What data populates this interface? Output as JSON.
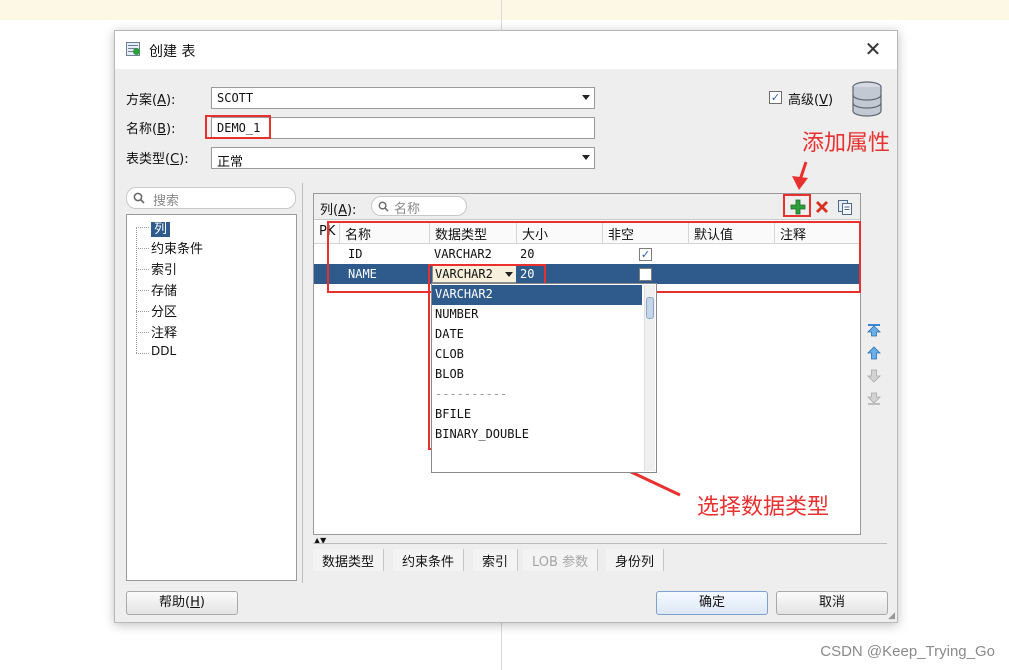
{
  "page": {
    "watermark": "CSDN @Keep_Trying_Go"
  },
  "dialog": {
    "title": "创建 表",
    "schema": {
      "label_pre": "方案(",
      "label_key": "A",
      "label_post": "):",
      "value": "SCOTT"
    },
    "name": {
      "label_pre": "名称(",
      "label_key": "B",
      "label_post": "):",
      "value": "DEMO_1"
    },
    "table_type": {
      "label_pre": "表类型(",
      "label_key": "C",
      "label_post": "):",
      "value": "正常"
    },
    "advanced": {
      "label_pre": "高级(",
      "label_key": "V",
      "label_post": ")",
      "checked": true
    }
  },
  "left_panel": {
    "search_placeholder": "搜索",
    "items": [
      {
        "label": "列",
        "selected": true
      },
      {
        "label": "约束条件"
      },
      {
        "label": "索引"
      },
      {
        "label": "存储"
      },
      {
        "label": "分区"
      },
      {
        "label": "注释"
      },
      {
        "label": "DDL"
      }
    ]
  },
  "columns_panel": {
    "label_pre": "列(",
    "label_key": "A",
    "label_post": "):",
    "search_placeholder": "名称",
    "headers": [
      "PK",
      "名称",
      "数据类型",
      "大小",
      "非空",
      "默认值",
      "注释"
    ],
    "rows": [
      {
        "pk": "",
        "name": "ID",
        "type": "VARCHAR2",
        "size": "20",
        "not_null": true,
        "default": "",
        "comment": ""
      },
      {
        "pk": "",
        "name": "NAME",
        "type": "VARCHAR2",
        "size": "20",
        "not_null": false,
        "default": "",
        "comment": ""
      }
    ],
    "type_options": [
      "VARCHAR2",
      "NUMBER",
      "DATE",
      "CLOB",
      "BLOB",
      "----------",
      "BFILE",
      "BINARY_DOUBLE"
    ],
    "selected_type": "VARCHAR2"
  },
  "tabs": [
    {
      "label": "数据类型",
      "enabled": true
    },
    {
      "label": "约束条件",
      "enabled": true
    },
    {
      "label": "索引",
      "enabled": true
    },
    {
      "label": "LOB 参数",
      "enabled": false
    },
    {
      "label": "身份列",
      "enabled": true
    }
  ],
  "buttons": {
    "help_pre": "帮助(",
    "help_key": "H",
    "help_post": ")",
    "ok": "确定",
    "cancel": "取消"
  },
  "annotations": {
    "add_attribute": "添加属性",
    "choose_type": "选择数据类型"
  },
  "colors": {
    "selection": "#2e5a8c",
    "annotation": "#e8312f",
    "add_icon": "#2e9e3c",
    "delete_icon": "#d8321f"
  }
}
